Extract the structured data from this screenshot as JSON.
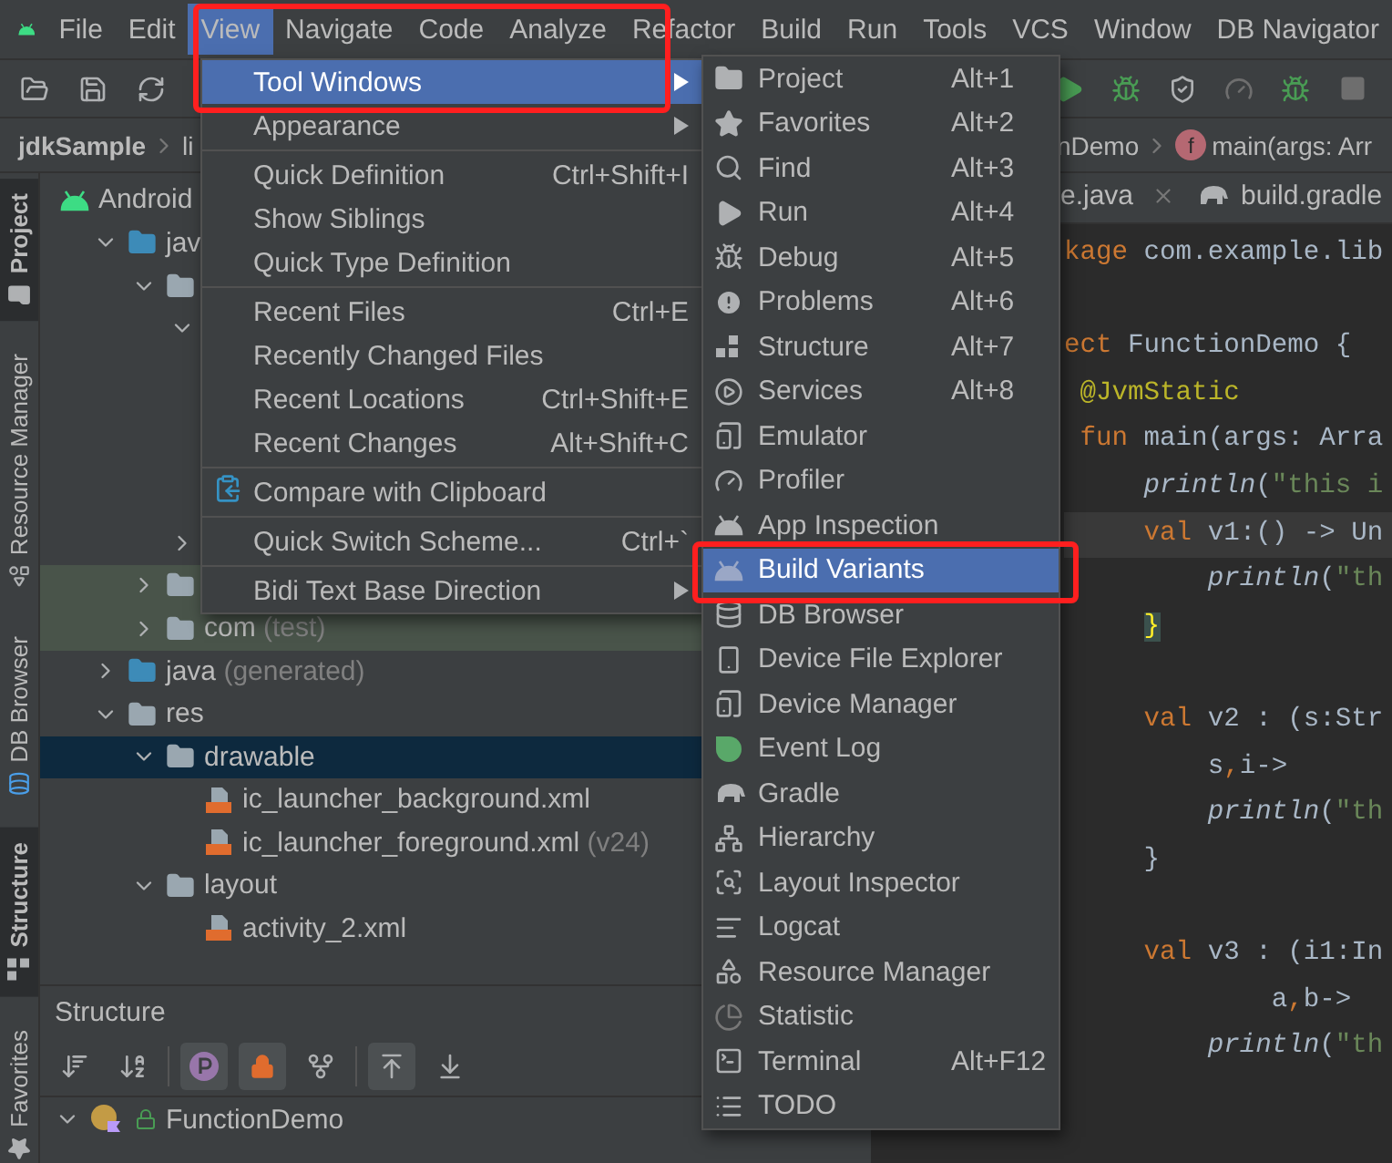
{
  "menu_bar": [
    {
      "label": "File",
      "selected": false
    },
    {
      "label": "Edit",
      "selected": false
    },
    {
      "label": "View",
      "selected": true,
      "annotated": true
    },
    {
      "label": "Navigate",
      "selected": false
    },
    {
      "label": "Code",
      "selected": false
    },
    {
      "label": "Analyze",
      "selected": false
    },
    {
      "label": "Refactor",
      "selected": false
    },
    {
      "label": "Build",
      "selected": false
    },
    {
      "label": "Run",
      "selected": false
    },
    {
      "label": "Tools",
      "selected": false
    },
    {
      "label": "VCS",
      "selected": false
    },
    {
      "label": "Window",
      "selected": false
    },
    {
      "label": "DB Navigator",
      "selected": false
    }
  ],
  "breadcrumb": {
    "left": [
      "jdkSample",
      "li"
    ],
    "right": [
      {
        "label": "nDemo"
      },
      {
        "label": "main(args: Arr",
        "badge": "f"
      }
    ]
  },
  "side_tabs": [
    {
      "label": "Project",
      "selected": true
    },
    {
      "label": "Resource Manager",
      "selected": false
    },
    {
      "label": "DB Browser",
      "selected": false
    },
    {
      "label": "Structure",
      "selected": true
    },
    {
      "label": "Favorites",
      "selected": false
    }
  ],
  "project_tree": {
    "label": "Android",
    "kind": "module",
    "selected": false,
    "children": [
      {
        "label": "jav",
        "kind": "source",
        "expanded": true,
        "selected": false,
        "children": [
          {
            "kind": "package",
            "expanded": true,
            "selected": false,
            "children": [
              {
                "expanded": true,
                "selected": false
              },
              {
                "expanded": false,
                "selected": false
              }
            ]
          },
          {
            "kind": "package",
            "expanded": false,
            "selected": false,
            "test": true
          },
          {
            "label": "com",
            "note": "(test)",
            "kind": "package",
            "expanded": false,
            "selected": false,
            "test": true
          }
        ]
      },
      {
        "label": "java",
        "note": "(generated)",
        "kind": "generated",
        "expanded": false,
        "selected": false
      },
      {
        "label": "res",
        "kind": "resources",
        "expanded": true,
        "selected": false,
        "children": [
          {
            "label": "drawable",
            "kind": "package",
            "expanded": true,
            "selected": true,
            "children": [
              {
                "label": "ic_launcher_background.xml",
                "kind": "xml",
                "selected": false
              },
              {
                "label": "ic_launcher_foreground.xml",
                "note": "(v24)",
                "kind": "xml",
                "selected": false
              }
            ]
          },
          {
            "label": "layout",
            "kind": "package",
            "expanded": true,
            "selected": false,
            "children": [
              {
                "label": "activity_2.xml",
                "kind": "xml",
                "selected": false
              }
            ]
          }
        ]
      }
    ]
  },
  "structure_panel": {
    "title": "Structure",
    "tools": [
      {
        "on": false
      },
      {
        "on": false
      },
      {
        "on": true
      },
      {
        "on": true
      },
      {
        "on": false
      },
      {
        "on": true
      },
      {
        "on": false
      }
    ],
    "tree": [
      {
        "label": "FunctionDemo",
        "expanded": true
      }
    ]
  },
  "editor": {
    "tabs": [
      {
        "label": "e.java",
        "selected": false,
        "closable": true
      },
      {
        "label": "build.gradle",
        "selected": false
      }
    ],
    "lines": [
      {
        "kind": "code",
        "tokens": [
          {
            "text": "kage",
            "kind": "kw"
          },
          {
            "text": " com.example.lib",
            "kind": "plain"
          }
        ]
      },
      {
        "kind": "blank"
      },
      {
        "kind": "code",
        "tokens": [
          {
            "text": "ect",
            "kind": "kw"
          },
          {
            "text": " FunctionDemo {",
            "kind": "plain"
          }
        ]
      },
      {
        "kind": "code",
        "tokens": [
          {
            "text": " @JvmStatic",
            "kind": "ann"
          }
        ]
      },
      {
        "kind": "code",
        "tokens": [
          {
            "text": " fun",
            "kind": "kw"
          },
          {
            "text": " main(args: Arra",
            "kind": "plain"
          }
        ]
      },
      {
        "kind": "code",
        "tokens": [
          {
            "text": "     println",
            "kind": "call"
          },
          {
            "text": "(",
            "kind": "plain"
          },
          {
            "text": "\"this i",
            "kind": "str"
          }
        ]
      },
      {
        "kind": "code",
        "current": true,
        "tokens": [
          {
            "text": "     val",
            "kind": "kw"
          },
          {
            "text": " v1:() -> Un",
            "kind": "plain"
          }
        ]
      },
      {
        "kind": "code",
        "tokens": [
          {
            "text": "         println",
            "kind": "call"
          },
          {
            "text": "(",
            "kind": "plain"
          },
          {
            "text": "\"th",
            "kind": "str"
          }
        ]
      },
      {
        "kind": "code",
        "tokens": [
          {
            "text": "     }",
            "kind": "brace"
          }
        ]
      },
      {
        "kind": "blank"
      },
      {
        "kind": "code",
        "tokens": [
          {
            "text": "     val",
            "kind": "kw"
          },
          {
            "text": " v2 : (s:Str",
            "kind": "plain"
          }
        ]
      },
      {
        "kind": "code",
        "tokens": [
          {
            "text": "         s",
            "kind": "plain"
          },
          {
            "text": ",",
            "kind": "kw"
          },
          {
            "text": "i->",
            "kind": "plain"
          }
        ]
      },
      {
        "kind": "code",
        "tokens": [
          {
            "text": "         println",
            "kind": "call"
          },
          {
            "text": "(",
            "kind": "plain"
          },
          {
            "text": "\"th",
            "kind": "str"
          }
        ]
      },
      {
        "kind": "code",
        "tokens": [
          {
            "text": "     }",
            "kind": "plain"
          }
        ]
      },
      {
        "kind": "blank"
      },
      {
        "kind": "code",
        "tokens": [
          {
            "text": "     val",
            "kind": "kw"
          },
          {
            "text": " v3 : (i1:In",
            "kind": "plain"
          }
        ]
      },
      {
        "kind": "code",
        "tokens": [
          {
            "text": "             a",
            "kind": "plain"
          },
          {
            "text": ",",
            "kind": "kw"
          },
          {
            "text": "b->",
            "kind": "plain"
          }
        ]
      },
      {
        "kind": "code",
        "tokens": [
          {
            "text": "         println",
            "kind": "call"
          },
          {
            "text": "(",
            "kind": "plain"
          },
          {
            "text": "\"th",
            "kind": "str"
          }
        ]
      }
    ]
  },
  "view_menu": {
    "sections": [
      {
        "items": [
          {
            "label": "Tool Windows",
            "kind": "submenu",
            "selected": true,
            "annotated": true
          },
          {
            "label": "Appearance",
            "kind": "submenu",
            "selected": false
          }
        ]
      },
      {
        "items": [
          {
            "label": "Quick Definition",
            "shortcut": "Ctrl+Shift+I",
            "kind": "plain",
            "selected": false
          },
          {
            "label": "Show Siblings",
            "kind": "plain",
            "selected": false
          },
          {
            "label": "Quick Type Definition",
            "kind": "plain",
            "selected": false
          }
        ]
      },
      {
        "items": [
          {
            "label": "Recent Files",
            "shortcut": "Ctrl+E",
            "kind": "plain",
            "selected": false
          },
          {
            "label": "Recently Changed Files",
            "kind": "plain",
            "selected": false
          },
          {
            "label": "Recent Locations",
            "shortcut": "Ctrl+Shift+E",
            "kind": "plain",
            "selected": false
          },
          {
            "label": "Recent Changes",
            "shortcut": "Alt+Shift+C",
            "kind": "plain",
            "selected": false
          }
        ]
      },
      {
        "items": [
          {
            "label": "Compare with Clipboard",
            "kind": "icon",
            "selected": false
          }
        ]
      },
      {
        "items": [
          {
            "label": "Quick Switch Scheme...",
            "shortcut": "Ctrl+`",
            "kind": "plain",
            "selected": false
          }
        ]
      },
      {
        "items": [
          {
            "label": "Bidi Text Base Direction",
            "kind": "submenu",
            "selected": false
          }
        ]
      }
    ]
  },
  "tool_windows_menu": {
    "items": [
      {
        "label": "Project",
        "shortcut": "Alt+1",
        "selected": false
      },
      {
        "label": "Favorites",
        "shortcut": "Alt+2",
        "selected": false
      },
      {
        "label": "Find",
        "shortcut": "Alt+3",
        "selected": false
      },
      {
        "label": "Run",
        "shortcut": "Alt+4",
        "selected": false
      },
      {
        "label": "Debug",
        "shortcut": "Alt+5",
        "selected": false
      },
      {
        "label": "Problems",
        "shortcut": "Alt+6",
        "selected": false
      },
      {
        "label": "Structure",
        "shortcut": "Alt+7",
        "selected": false
      },
      {
        "label": "Services",
        "shortcut": "Alt+8",
        "selected": false
      },
      {
        "label": "Emulator",
        "selected": false
      },
      {
        "label": "Profiler",
        "selected": false
      },
      {
        "label": "App Inspection",
        "selected": false
      },
      {
        "label": "Build Variants",
        "selected": true,
        "annotated": true
      },
      {
        "label": "DB Browser",
        "selected": false
      },
      {
        "label": "Device File Explorer",
        "selected": false
      },
      {
        "label": "Device Manager",
        "selected": false
      },
      {
        "label": "Event Log",
        "selected": false
      },
      {
        "label": "Gradle",
        "selected": false
      },
      {
        "label": "Hierarchy",
        "selected": false
      },
      {
        "label": "Layout Inspector",
        "selected": false
      },
      {
        "label": "Logcat",
        "selected": false
      },
      {
        "label": "Resource Manager",
        "selected": false
      },
      {
        "label": "Statistic",
        "selected": false
      },
      {
        "label": "Terminal",
        "shortcut": "Alt+F12",
        "selected": false
      },
      {
        "label": "TODO",
        "selected": false
      }
    ]
  }
}
